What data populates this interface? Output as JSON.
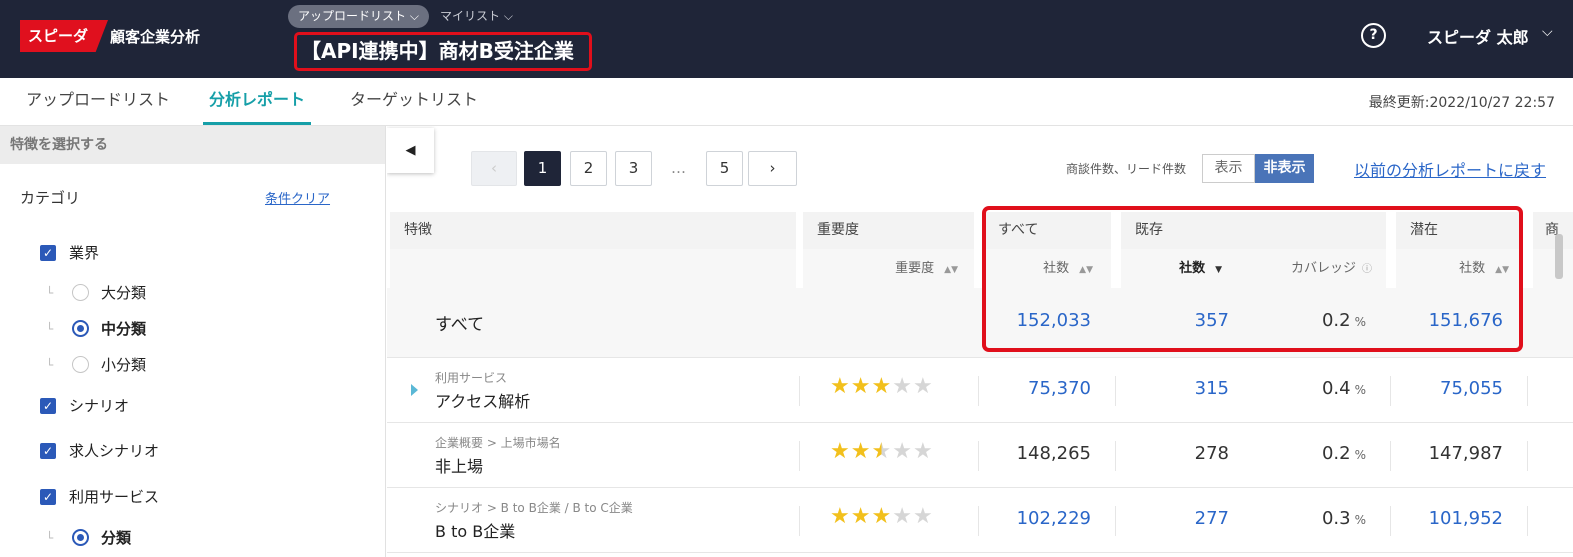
{
  "header": {
    "logo": "スピーダ",
    "app_name": "顧客企業分析",
    "crumb_button": "アップロードリスト",
    "crumb_link": "マイリスト",
    "title": "【API連携中】商材B受注企業",
    "user_name": "スピーダ 太郎"
  },
  "tabs": [
    {
      "label": "アップロードリスト",
      "active": false
    },
    {
      "label": "分析レポート",
      "active": true
    },
    {
      "label": "ターゲットリスト",
      "active": false
    }
  ],
  "last_updated": "最終更新:2022/10/27 22:57",
  "sidebar": {
    "header": "特徴を選択する",
    "category_label": "カテゴリ",
    "clear_link": "条件クリア",
    "items": [
      {
        "type": "checkbox",
        "label": "業界",
        "checked": true
      },
      {
        "type": "radio",
        "label": "大分類",
        "selected": false
      },
      {
        "type": "radio",
        "label": "中分類",
        "selected": true
      },
      {
        "type": "radio",
        "label": "小分類",
        "selected": false
      },
      {
        "type": "checkbox",
        "label": "シナリオ",
        "checked": true
      },
      {
        "type": "checkbox",
        "label": "求人シナリオ",
        "checked": true
      },
      {
        "type": "checkbox",
        "label": "利用サービス",
        "checked": true
      },
      {
        "type": "radio",
        "label": "分類",
        "selected": true
      }
    ]
  },
  "pagination": {
    "prev": "‹",
    "pages": [
      "1",
      "2",
      "3"
    ],
    "ellipsis": "…",
    "last": "5",
    "next": "›",
    "current": "1"
  },
  "toggle": {
    "label": "商談件数、リード件数",
    "show": "表示",
    "hide": "非表示",
    "selected": "非表示"
  },
  "back_link": "以前の分析レポートに戻す",
  "table": {
    "headers": {
      "feature": "特徴",
      "importance": "重要度",
      "all": "すべて",
      "existing": "既存",
      "potential": "潜在",
      "cut": "商"
    },
    "subheaders": {
      "importance": "重要度",
      "all_count": "社数",
      "existing_count": "社数",
      "coverage": "カバレッジ",
      "potential_count": "社数"
    },
    "total_row": {
      "name": "すべて",
      "all": "152,033",
      "existing": "357",
      "coverage": "0.2",
      "coverage_unit": "%",
      "potential": "151,676"
    },
    "rows": [
      {
        "category": "利用サービス",
        "name": "アクセス解析",
        "stars": 3,
        "all": "75,370",
        "existing": "315",
        "coverage": "0.4",
        "potential": "75,055",
        "linked": true
      },
      {
        "category": "企業概要 > 上場市場名",
        "name": "非上場",
        "stars": 2.5,
        "all": "148,265",
        "existing": "278",
        "coverage": "0.2",
        "potential": "147,987",
        "linked": false
      },
      {
        "category": "シナリオ > B to B企業 / B to C企業",
        "name": "B to B企業",
        "stars": 3,
        "all": "102,229",
        "existing": "277",
        "coverage": "0.3",
        "potential": "101,952",
        "linked": true
      }
    ]
  },
  "colors": {
    "header_bg": "#1f2538",
    "brand_red": "#e0101e",
    "accent_teal": "#169fa8",
    "link_blue": "#2a66c8",
    "highlight_red": "#e00f1b",
    "star_gold": "#f2c01c"
  }
}
